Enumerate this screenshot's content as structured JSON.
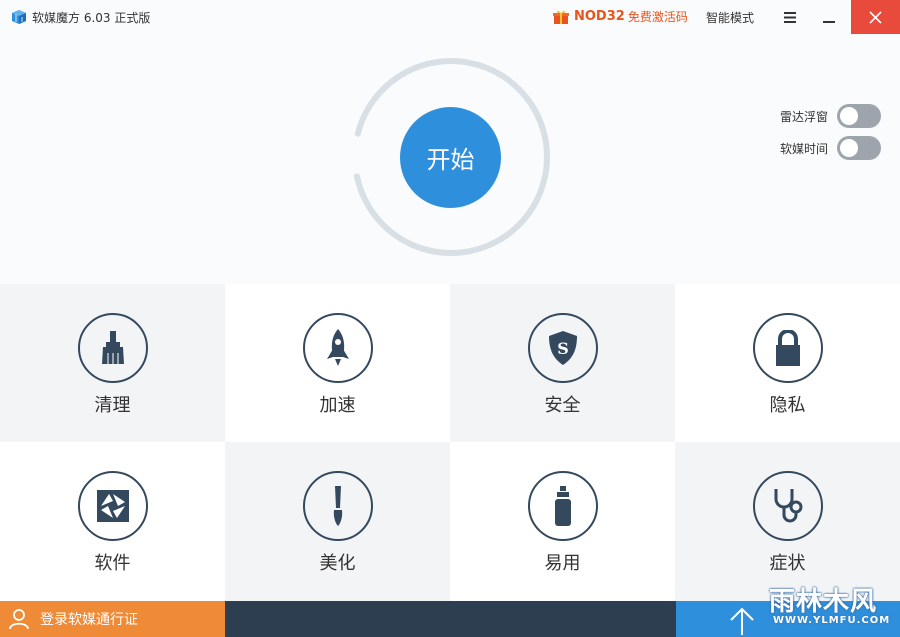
{
  "titlebar": {
    "app_title": "软媒魔方 6.03 正式版",
    "promo_nod": "NOD32",
    "promo_free": "免费激活码",
    "mode_label": "智能模式",
    "icons": [
      "cube-logo-icon",
      "gift-icon",
      "menu-icon",
      "minimize-icon",
      "close-icon"
    ]
  },
  "main": {
    "start_label": "开始",
    "toggles": [
      {
        "label": "雷达浮窗",
        "on": false
      },
      {
        "label": "软媒时间",
        "on": false
      }
    ]
  },
  "tiles": [
    {
      "label": "清理",
      "icon": "broom-icon"
    },
    {
      "label": "加速",
      "icon": "rocket-icon"
    },
    {
      "label": "安全",
      "icon": "shield-icon"
    },
    {
      "label": "隐私",
      "icon": "lock-icon"
    },
    {
      "label": "软件",
      "icon": "aperture-icon"
    },
    {
      "label": "美化",
      "icon": "paintbrush-icon"
    },
    {
      "label": "易用",
      "icon": "bottle-icon"
    },
    {
      "label": "症状",
      "icon": "stethoscope-icon"
    }
  ],
  "bottom": {
    "login_label": "登录软媒通行证"
  },
  "watermark": {
    "top": "雨林木风",
    "bottom": "WWW.YLMFU.COM"
  },
  "colors": {
    "accent_blue": "#2e8fdc",
    "close_red": "#e84b3c",
    "login_orange": "#ef8a36",
    "bottom_dark": "#2d3e50",
    "promo_orange": "#e8541c",
    "icon_dark": "#34495e"
  }
}
